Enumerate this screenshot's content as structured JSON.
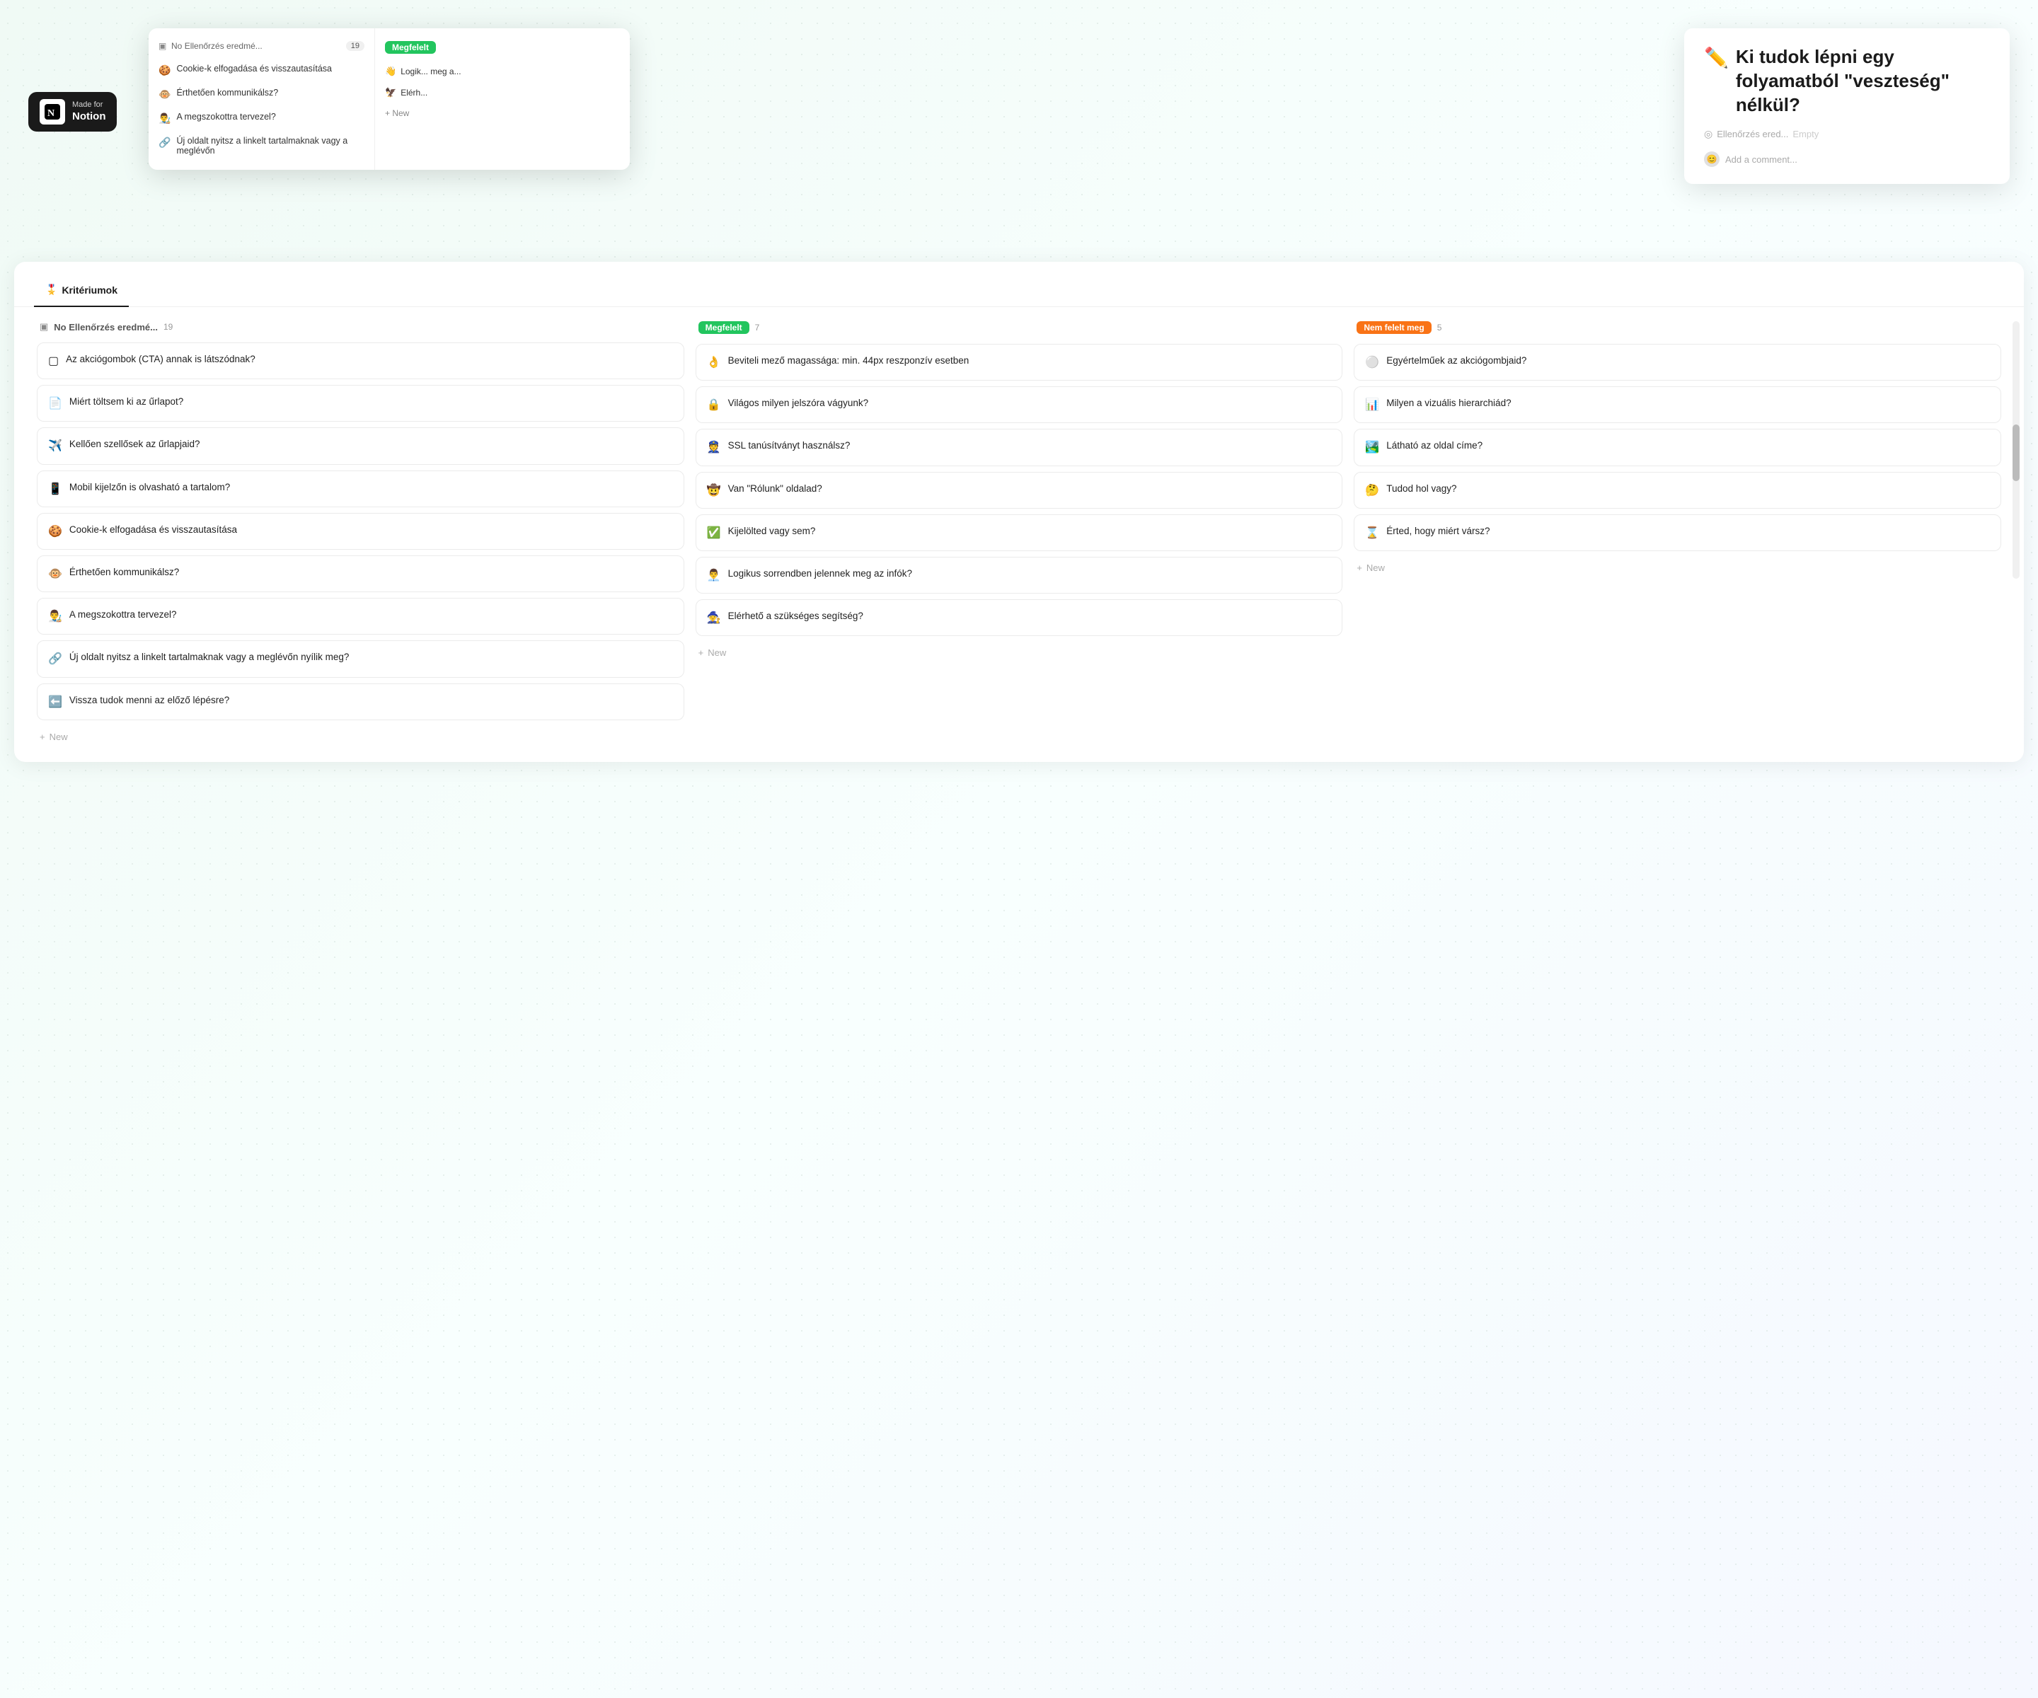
{
  "badge": {
    "made_for": "Made for",
    "notion": "Notion",
    "icon_text": "N"
  },
  "floating_preview": {
    "left_header": "No Ellenőrzés eredmé...",
    "left_count": "19",
    "items": [
      {
        "emoji": "🍪",
        "text": "Cookie-k elfogadása és visszautasítása"
      },
      {
        "emoji": "🐵",
        "text": "Érthetően kommunikálsz?"
      },
      {
        "emoji": "👨‍🎨",
        "text": "A megszokottra tervezel?"
      },
      {
        "emoji": "🔗",
        "text": "Új oldalt nyitsz a linkelt tartalmaknak vagy a meglévőn"
      }
    ],
    "right_header_text": "Megfelelt",
    "right_items": [
      {
        "emoji": "👋",
        "text": "Logik... meg a..."
      },
      {
        "emoji": "🦅",
        "text": "Elérh..."
      }
    ],
    "new_label": "+ New"
  },
  "detail_panel": {
    "pencil_emoji": "✏️",
    "title": "Ki tudok lépni egy folyamatból \"veszteség\" nélkül?",
    "meta_icon": "◎",
    "meta_text": "Ellenőrzés ered...",
    "meta_empty": "Empty",
    "comment_placeholder": "Add a comment...",
    "cursor": "|"
  },
  "main": {
    "tab_icon": "🎖️",
    "tab_label": "Kritériumok",
    "columns": [
      {
        "id": "no_check",
        "title_text": "No Ellenőrzés eredmé...",
        "count": "19",
        "badge_type": "plain",
        "cards": [
          {
            "emoji": "▢",
            "text": "Az akciógombok (CTA) annak is látszódnak?"
          },
          {
            "emoji": "📄",
            "text": "Miért töltsem ki az űrlapot?"
          },
          {
            "emoji": "✈️",
            "text": "Kellően szellősek az űrlapjaid?"
          },
          {
            "emoji": "📱",
            "text": "Mobil kijelzőn is olvasható a tartalom?"
          },
          {
            "emoji": "🍪",
            "text": "Cookie-k elfogadása és visszautasítása"
          },
          {
            "emoji": "🐵",
            "text": "Érthetően kommunikálsz?"
          },
          {
            "emoji": "👨‍🎨",
            "text": "A megszokottra tervezel?"
          },
          {
            "emoji": "🔗",
            "text": "Új oldalt nyitsz a linkelt tartalmaknak vagy a meglévőn nyílik meg?"
          },
          {
            "emoji": "⬅️",
            "text": "Vissza tudok menni az előző lépésre?"
          }
        ],
        "new_label": "+ New"
      },
      {
        "id": "megfelelt",
        "title_text": "Megfelelt",
        "count": "7",
        "badge_type": "green",
        "cards": [
          {
            "emoji": "👌",
            "text": "Beviteli mező magassága: min. 44px reszponzív esetben"
          },
          {
            "emoji": "🔒",
            "text": "Világos milyen jelszóra vágyunk?"
          },
          {
            "emoji": "👮",
            "text": "SSL tanúsítványt használsz?"
          },
          {
            "emoji": "🤠",
            "text": "Van \"Rólunk\" oldalad?"
          },
          {
            "emoji": "✅",
            "text": "Kijelölted vagy sem?"
          },
          {
            "emoji": "👨‍💼",
            "text": "Logikus sorrendben jelennek meg az infók?"
          },
          {
            "emoji": "🧙",
            "text": "Elérhető a szükséges segítség?"
          }
        ],
        "new_label": "+ New"
      },
      {
        "id": "nem_felelt",
        "title_text": "Nem felelt meg",
        "count": "5",
        "badge_type": "orange",
        "cards": [
          {
            "emoji": "⚪",
            "text": "Egyértelműek az akciógombjaid?"
          },
          {
            "emoji": "📊",
            "text": "Milyen a vizuális hierarchiád?"
          },
          {
            "emoji": "🏞️",
            "text": "Látható az oldal címe?"
          },
          {
            "emoji": "🤔",
            "text": "Tudod hol vagy?"
          },
          {
            "emoji": "⌛",
            "text": "Érted, hogy miért vársz?"
          }
        ],
        "new_label": "+ New"
      }
    ]
  }
}
